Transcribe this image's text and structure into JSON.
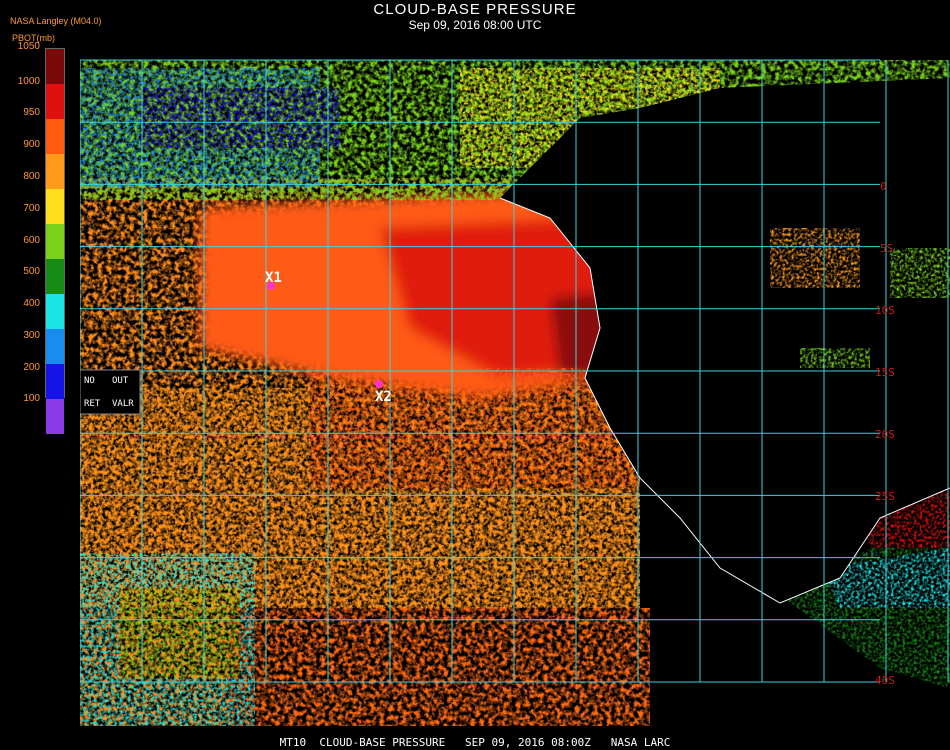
{
  "header": {
    "title": "CLOUD-BASE PRESSURE",
    "subtitle": "Sep 09, 2016 08:00 UTC",
    "credit": "NASA Langley (M04.0)",
    "units": "PBOT(mb)"
  },
  "legend": {
    "ticks": [
      "1050",
      "1000",
      "950",
      "900",
      "800",
      "700",
      "600",
      "500",
      "400",
      "300",
      "200",
      "100"
    ],
    "colors": [
      "#7a0a0a",
      "#e01010",
      "#ff5a10",
      "#ff9a1a",
      "#ffe01a",
      "#7ad21a",
      "#168c16",
      "#1ae6e6",
      "#1a8cf0",
      "#1414e6",
      "#8a3ae6"
    ],
    "no_data_labels": [
      "NO",
      "OUT",
      "RET",
      "VALR"
    ]
  },
  "map": {
    "latitude_labels": [
      "0",
      "5S",
      "10S",
      "15S",
      "20S",
      "25S",
      "40S"
    ],
    "grid_color": "#3cd2dc",
    "markers": [
      {
        "label": "X1",
        "color": "#ff33cc"
      },
      {
        "label": "X2",
        "color": "#ff33cc"
      }
    ]
  },
  "footer": {
    "text": "MT10  CLOUD-BASE PRESSURE   SEP 09, 2016 08:00Z   NASA LARC"
  }
}
